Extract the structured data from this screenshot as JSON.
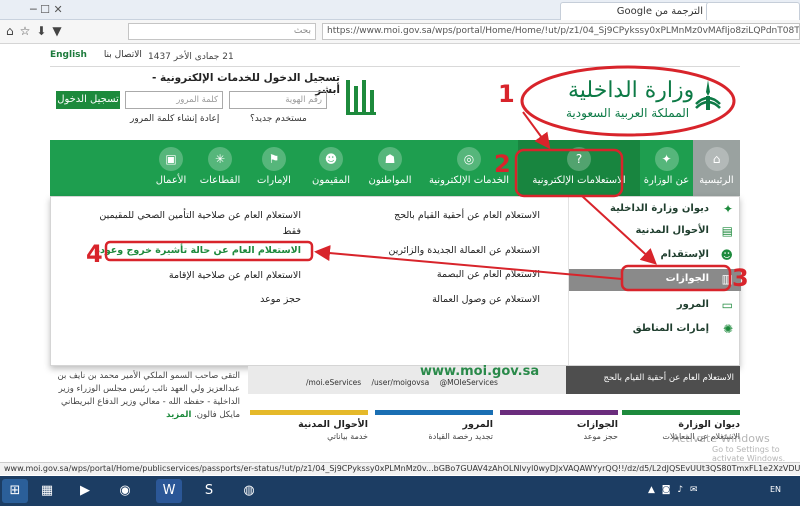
{
  "browser": {
    "tab_translate": "الترجمة من Google",
    "tab_new": "",
    "search_placeholder": "بحث",
    "url": "https://www.moi.gov.sa/wps/portal/Home/Home/!ut/p/z1/04_Sj9CPykssy0xPLMnMz0vMAfIjo8ziLQPdnT08Tly83Q8dzQwcPc2N_A08",
    "status_url": "www.moi.gov.sa/wps/portal/Home/publicservices/passports/er-status/!ut/p/z1/04_Sj9CPykssy0xPLMnMz0v...bGBo7GUAV4zAhOLNlvyl0wyDJxVAQAWYyrQQ!!/dz/d5/L2dJQSEvUUt3QS80TmxFL1e2XzVDUENJOE0zMUdQVTcwMkY3NEp"
  },
  "header": {
    "english": "English",
    "contact": "الاتصال بنا",
    "date": "21 جمادى الأخر 1437",
    "absher_title": "تسجيل الدخول للخدمات الإلكترونية - أبشر",
    "login_button": "تسجيل الدخول",
    "password_placeholder": "كلمة المرور",
    "id_placeholder": "رقم الهوية",
    "new_user": "مستخدم جديد؟",
    "create_password": "إعادة إنشاء كلمة المرور",
    "moi_name": "وزارة الداخلية",
    "moi_sub": "المملكة العربية السعودية"
  },
  "nav": [
    {
      "label": "الرئيسية",
      "icon": "home-icon"
    },
    {
      "label": "عن الوزارة",
      "icon": "emblem-icon"
    },
    {
      "label": "الاستعلامات الإلكترونية",
      "icon": "inquiry-icon"
    },
    {
      "label": "الخدمات الإلكترونية",
      "icon": "globe-icon"
    },
    {
      "label": "المواطنون",
      "icon": "citizen-icon"
    },
    {
      "label": "المقيمون",
      "icon": "residents-icon"
    },
    {
      "label": "الإمارات",
      "icon": "emirates-icon"
    },
    {
      "label": "القطاعات",
      "icon": "sectors-icon"
    },
    {
      "label": "الأعمال",
      "icon": "business-icon"
    }
  ],
  "dropdown": {
    "sidebar": [
      {
        "label": "ديوان وزارة الداخلية"
      },
      {
        "label": "الأحوال المدنية"
      },
      {
        "label": "الإستقدام"
      },
      {
        "label": "الجوازات"
      },
      {
        "label": "المرور"
      },
      {
        "label": "إمارات المناطق"
      }
    ],
    "links_col1": [
      "الاستعلام العام عن أحقية القيام بالحج",
      "الاستعلام عن العمالة الجديدة والزائرين",
      "الاستعلام العام عن البصمة",
      "الاستعلام عن وصول العمالة"
    ],
    "links_col2": [
      "الاستعلام العام عن صلاحية التأمين الصحي للمقيمين",
      "فقط",
      "الاستعلام العام عن حالة تأشيرة خروج وعودة",
      "الاستعلام العام عن صلاحية الإقامة",
      "حجز موعد"
    ]
  },
  "below": {
    "news_text": "التقى صاحب السمو الملكي الأمير محمد بن نايف بن عبدالعزيز ولي العهد نائب رئيس مجلس الوزراء وزير الداخلية - حفظه الله - معالي وزير الدفاع البريطاني مايكل فالون.",
    "more": "المزيد",
    "banner_url": "www.moi.gov.sa",
    "social": [
      "/moi.eServices",
      "/user/moigovsa",
      "@MOIeServices"
    ],
    "hajj_box": "الاستعلام العام عن أحقية القيام بالحج",
    "services": [
      {
        "title": "ديوان الوزارة",
        "sub": "الاستعلام عن المعاملات",
        "color": "#1d8a3c"
      },
      {
        "title": "الجوازات",
        "sub": "حجز موعد",
        "color": "#6b2d7d"
      },
      {
        "title": "المرور",
        "sub": "تجديد رخصة القيادة",
        "color": "#1a6fb3"
      },
      {
        "title": "الأحوال المدنية",
        "sub": "خدمة بياناتي",
        "color": "#e5b92a"
      }
    ],
    "watermark": "Activate Windows",
    "watermark_sub": "Go to Settings to activate Windows."
  },
  "annotations": [
    "1",
    "2",
    "3",
    "4"
  ],
  "taskbar": {
    "lang": "EN"
  }
}
